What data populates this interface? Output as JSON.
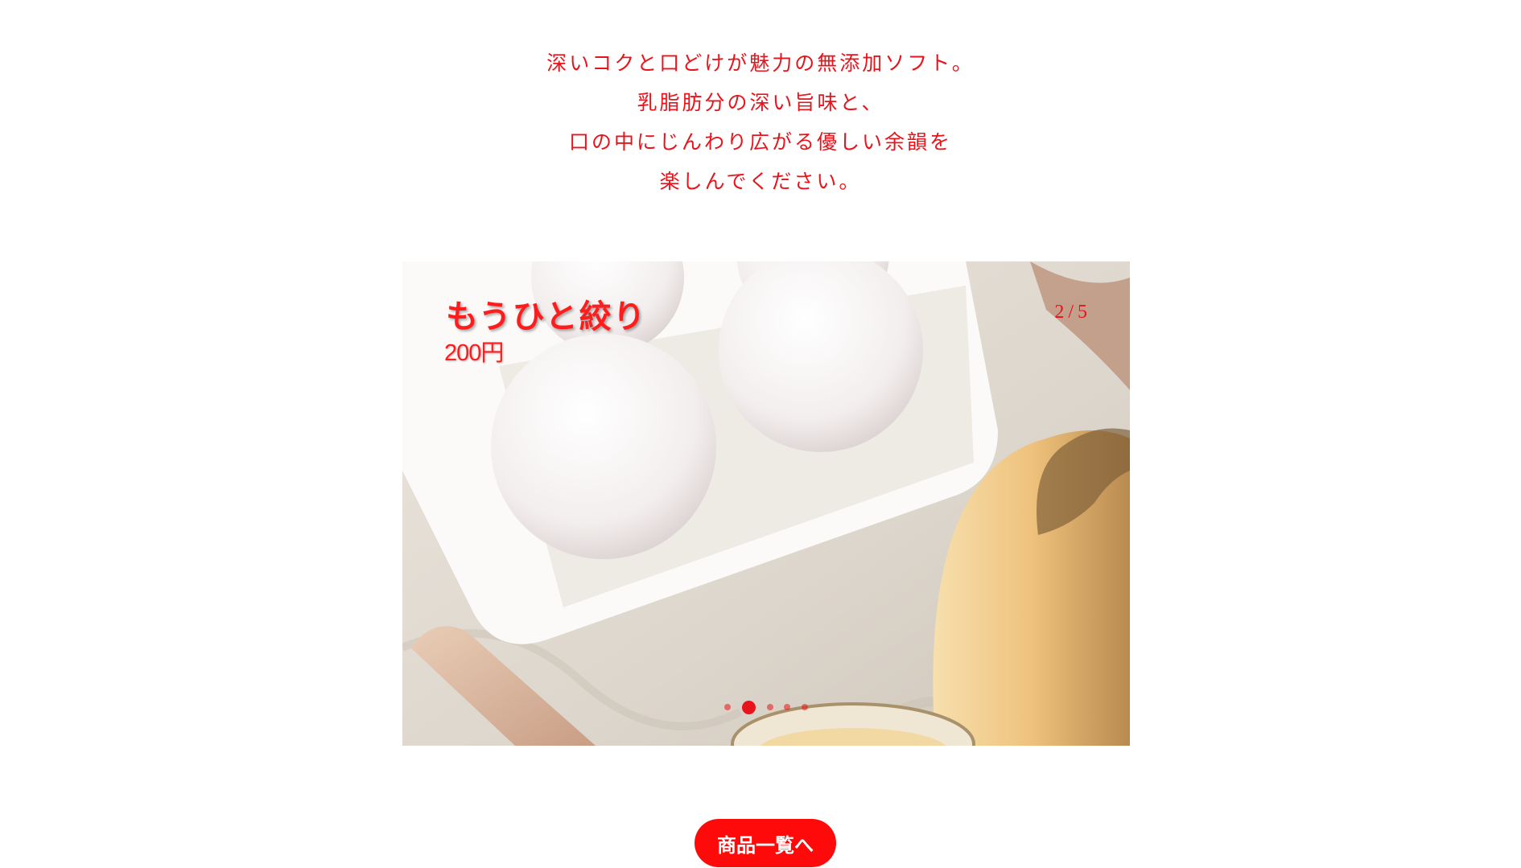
{
  "intro": {
    "lines": [
      "深いコクと口どけが魅力の無添加ソフト。",
      "乳脂肪分の深い旨味と、",
      "口の中にじんわり広がる優しい余韻を",
      "楽しんでください。"
    ]
  },
  "slider": {
    "product_name": "もうひと絞り",
    "price": "200円",
    "counter_current": "2",
    "counter_separator": "/",
    "counter_total": "5",
    "dots": {
      "count": 5,
      "active_index": 1
    },
    "photo": "egg-and-pudding-photo"
  },
  "button": {
    "label": "商品一覧へ"
  },
  "colors": {
    "accent": "#e8141b",
    "button_bg": "#ff0a0a",
    "button_text": "#ffffff",
    "background": "#ffffff"
  }
}
